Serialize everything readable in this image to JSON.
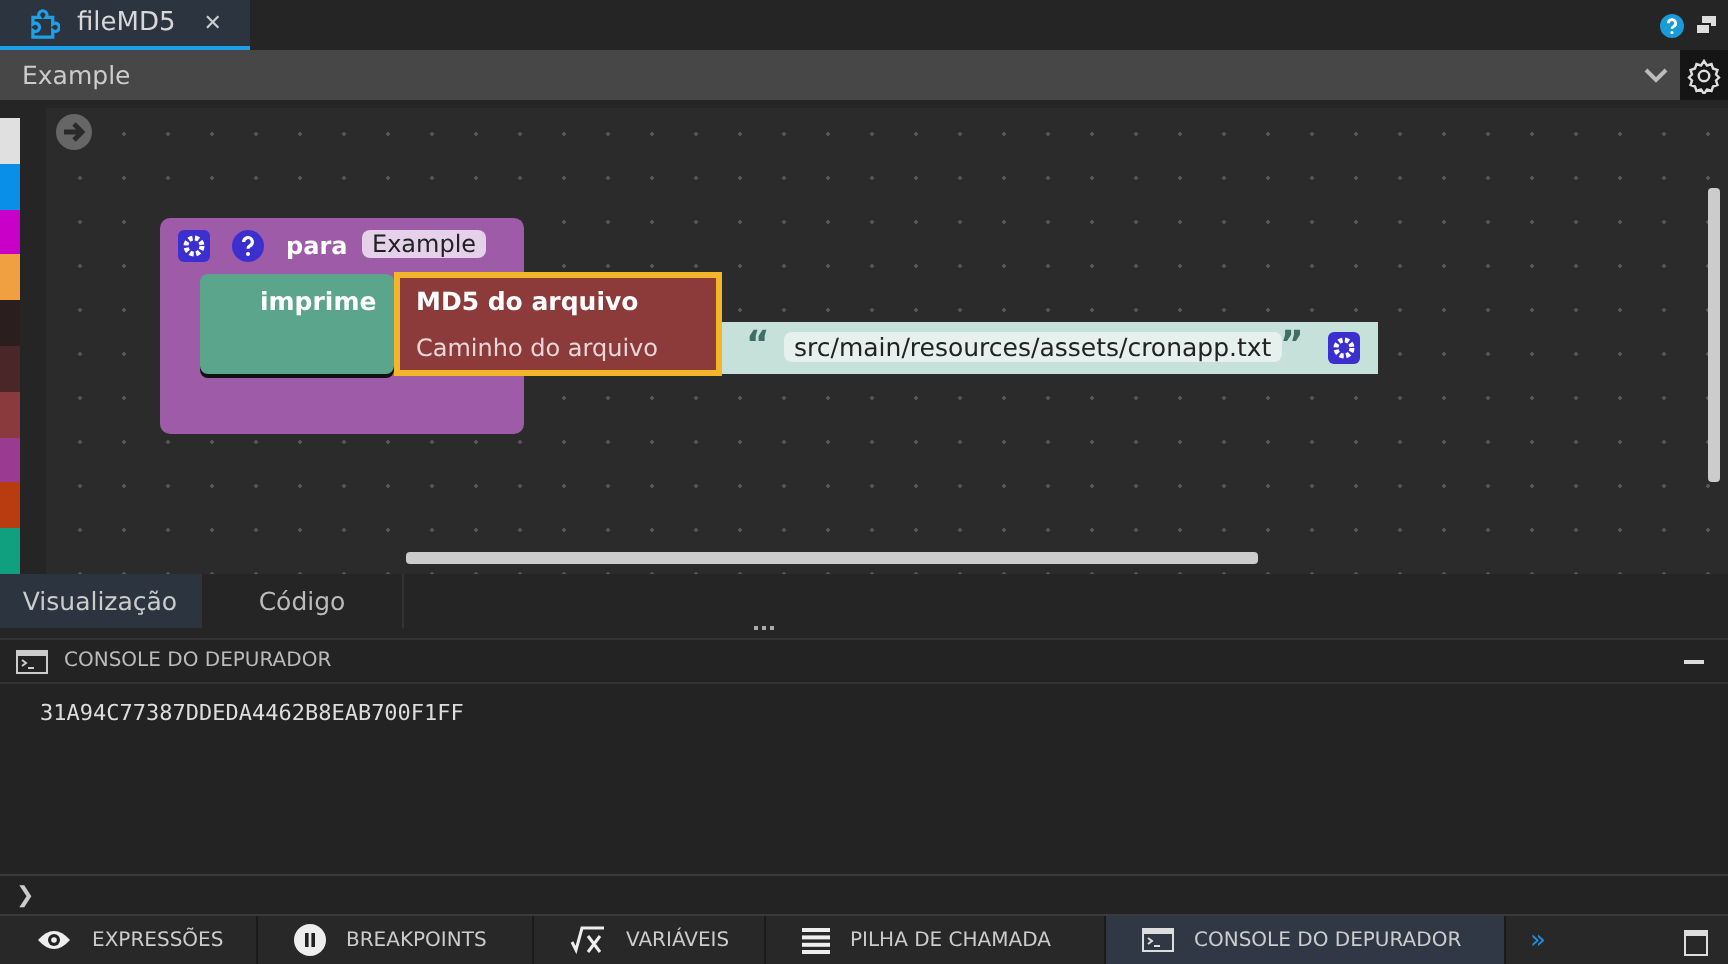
{
  "file_tab": {
    "title": "fileMD5",
    "close": "✕",
    "selected": true
  },
  "function_select": {
    "value": "Example"
  },
  "palette": [
    {
      "color": "#e0e0e0"
    },
    {
      "color": "#0a8fe8"
    },
    {
      "color": "#c800c8"
    },
    {
      "color": "#f0a040"
    },
    {
      "color": "#2a1e1e"
    },
    {
      "color": "#4a2628"
    },
    {
      "color": "#8a3a3c"
    },
    {
      "color": "#9a3a90"
    },
    {
      "color": "#b83c10"
    },
    {
      "color": "#10a080"
    }
  ],
  "blocks": {
    "function_label": "para",
    "function_name": "Example",
    "print_label": "imprime",
    "md5_title": "MD5 do arquivo",
    "md5_input_label": "Caminho do arquivo",
    "open_quote": "“",
    "path": "src/main/resources/assets/cronapp.txt",
    "close_quote": "”"
  },
  "view_tabs": [
    {
      "label": "Visualização",
      "selected": true
    },
    {
      "label": "Código",
      "selected": false
    }
  ],
  "console": {
    "title": "CONSOLE DO DEPURADOR",
    "output": "31A94C77387DDEDA4462B8EAB700F1FF",
    "prompt": "❯"
  },
  "bottom_tabs": [
    {
      "kind": "eye",
      "label": "EXPRESSÕES",
      "selected": false
    },
    {
      "kind": "pause",
      "label": "BREAKPOINTS",
      "selected": false
    },
    {
      "kind": "fx",
      "label": "VARIÁVEIS",
      "selected": false
    },
    {
      "kind": "list",
      "label": "PILHA DE CHAMADA",
      "selected": false
    },
    {
      "kind": "console",
      "label": "CONSOLE DO DEPURADOR",
      "selected": true
    }
  ],
  "more": "»"
}
